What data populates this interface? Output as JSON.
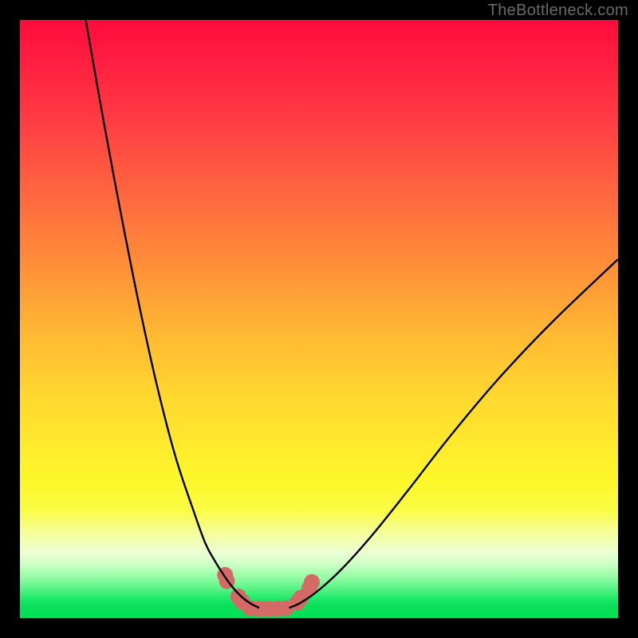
{
  "watermark": "TheBottleneck.com",
  "chart_data": {
    "type": "line",
    "title": "",
    "xlabel": "",
    "ylabel": "",
    "xlim": [
      0,
      100
    ],
    "ylim": [
      0,
      100
    ],
    "grid": false,
    "series": [
      {
        "name": "left-curve",
        "x": [
          11,
          14,
          17,
          20,
          23,
          26,
          29,
          31,
          32.5,
          34,
          35.2,
          36.4,
          37.6,
          38.8,
          40
        ],
        "values": [
          100,
          83,
          67,
          52,
          38.5,
          27,
          18,
          12.5,
          9.7,
          7.3,
          5.6,
          4.2,
          3.1,
          2.3,
          1.7
        ]
      },
      {
        "name": "right-curve",
        "x": [
          45,
          47,
          50,
          54,
          59,
          65,
          72,
          80,
          89,
          100
        ],
        "values": [
          1.7,
          2.6,
          4.7,
          8.4,
          14.0,
          21.5,
          30.5,
          40.0,
          49.5,
          60.0
        ]
      },
      {
        "name": "marker-band",
        "x": [
          34.3,
          34.6,
          36.5,
          37.2,
          38.5,
          40.0,
          41.5,
          43.0,
          44.5,
          46.4,
          47.0,
          48.4,
          48.8
        ],
        "values": [
          7.2,
          6.2,
          3.6,
          2.7,
          1.65,
          1.55,
          1.55,
          1.55,
          1.65,
          2.6,
          3.4,
          5.0,
          6.0
        ]
      }
    ],
    "annotations": []
  },
  "style": {
    "curve_stroke": "#000000",
    "curve_width": 2.4,
    "marker_fill": "#d46a66",
    "marker_radius": 10
  }
}
